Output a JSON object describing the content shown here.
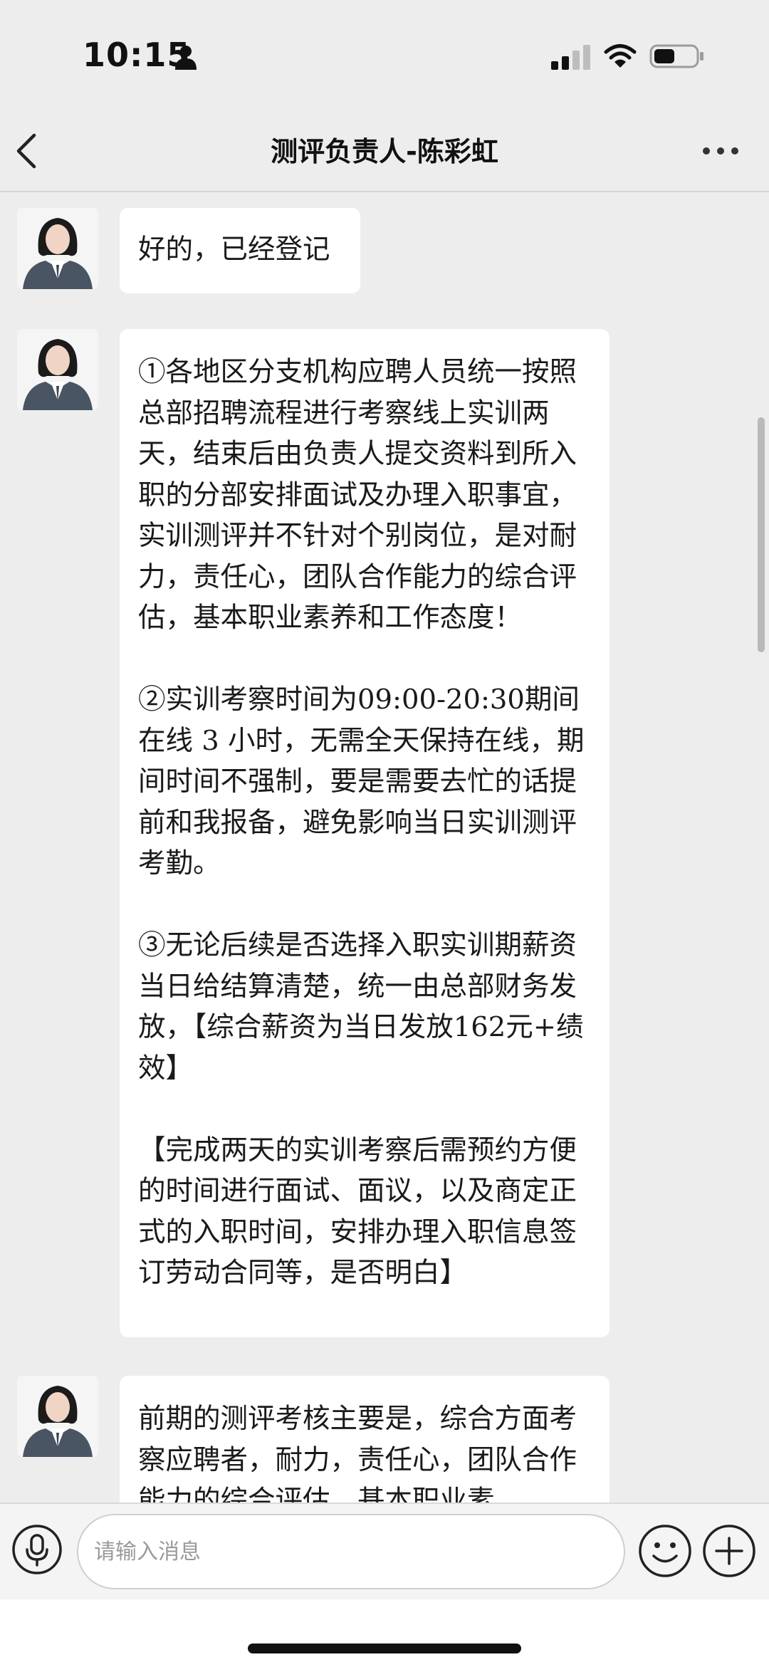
{
  "status_bar": {
    "time": "10:15",
    "icons": [
      "person-icon",
      "signal-icon",
      "wifi-icon",
      "battery-icon"
    ],
    "battery_level": 0.5
  },
  "nav": {
    "title": "测评负责人-陈彩虹",
    "back_icon": "chevron-left-icon",
    "more_icon": "more-icon"
  },
  "messages": [
    {
      "sender": "contact",
      "text": "好的，已经登记"
    },
    {
      "sender": "contact",
      "text": "①各地区分支机构应聘人员统一按照总部招聘流程进行考察线上实训两天，结束后由负责人提交资料到所入职的分部安排面试及办理入职事宜，实训测评并不针对个别岗位，是对耐力，责任心，团队合作能力的综合评估，基本职业素养和工作态度！\n\n②实训考察时间为09:00-20:30期间在线 3 小时，无需全天保持在线，期间时间不强制，要是需要去忙的话提前和我报备，避免影响当日实训测评考勤。\n\n③无论后续是否选择入职实训期薪资当日给结算清楚，统一由总部财务发放，【综合薪资为当日发放162元+绩效】\n\n【完成两天的实训考察后需预约方便的时间进行面试、面议，以及商定正式的入职时间，安排办理入职信息签订劳动合同等，是否明白】"
    },
    {
      "sender": "contact",
      "text": "前期的测评考核主要是，综合方面考察应聘者，耐力，责任心，团队合作能力的综合评估，基本职业素"
    }
  ],
  "input": {
    "placeholder": "请输入消息",
    "value": ""
  },
  "colors": {
    "background": "#ededed",
    "bubble": "#ffffff",
    "avatar_suit": "#4a5563"
  }
}
